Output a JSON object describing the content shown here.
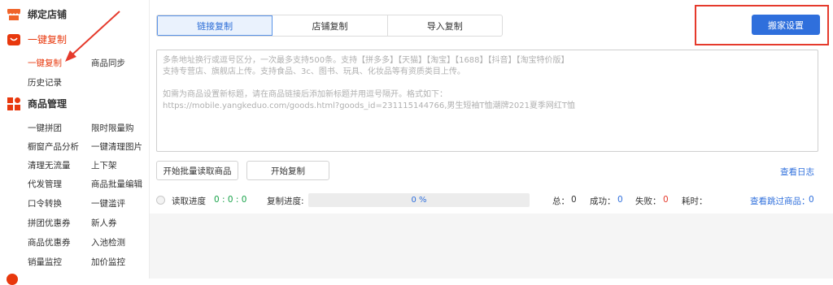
{
  "sidebar": {
    "sections": [
      {
        "title": "绑定店铺",
        "icon": "store-icon"
      },
      {
        "title": "一键复制",
        "icon": "cart-icon"
      },
      {
        "title": "商品管理",
        "icon": "grid-icon"
      }
    ],
    "copy_items": [
      "一键复制",
      "商品同步",
      "历史记录"
    ],
    "product_items": [
      [
        "一键拼团",
        "限时限量购"
      ],
      [
        "橱窗产品分析",
        "一键清理图片"
      ],
      [
        "清理无流量",
        "上下架"
      ],
      [
        "代发管理",
        "商品批量编辑"
      ],
      [
        "口令转换",
        "一键滥评"
      ],
      [
        "拼团优惠券",
        "新人券"
      ],
      [
        "商品优惠券",
        "入池检测"
      ],
      [
        "销量监控",
        "加价监控"
      ]
    ]
  },
  "tabs": [
    "链接复制",
    "店铺复制",
    "导入复制"
  ],
  "toolbar": {
    "settings_label": "搬家设置"
  },
  "textarea": {
    "placeholder_lines": [
      "多条地址换行或逗号区分，一次最多支持500条。支持【拼多多】【天猫】【淘宝】【1688】【抖音】【淘宝特价版】",
      "支持专营店、旗舰店上传。支持食品、3c、图书、玩具、化妆品等有资质类目上传。",
      "",
      "如需为商品设置新标题，请在商品链接后添加新标题并用逗号隔开。格式如下：",
      "https://mobile.yangkeduo.com/goods.html?goods_id=231115144766,男生短袖T恤潮牌2021夏季网红T恤"
    ]
  },
  "actions": {
    "batch_read_label": "开始批量读取商品",
    "start_copy_label": "开始复制",
    "view_log_label": "查看日志"
  },
  "status": {
    "read_progress_label": "读取进度",
    "read_progress_value": "0 : 0 : 0",
    "copy_progress_label": "复制进度:",
    "copy_progress_percent": 0,
    "copy_progress_text": "0 %",
    "total_label": "总：",
    "total_value": "0",
    "success_label": "成功：",
    "success_value": "0",
    "fail_label": "失败：",
    "fail_value": "0",
    "time_label": "耗时：",
    "view_skipped_label": "查看跳过商品：",
    "view_skipped_value": "0"
  },
  "colors": {
    "accent": "#2f6fdc",
    "brand_red": "#e8380d",
    "annotation_red": "#e53a2c",
    "success_blue": "#2f6fdc",
    "fail_red": "#e53a2c",
    "read_green": "#19a34a"
  }
}
